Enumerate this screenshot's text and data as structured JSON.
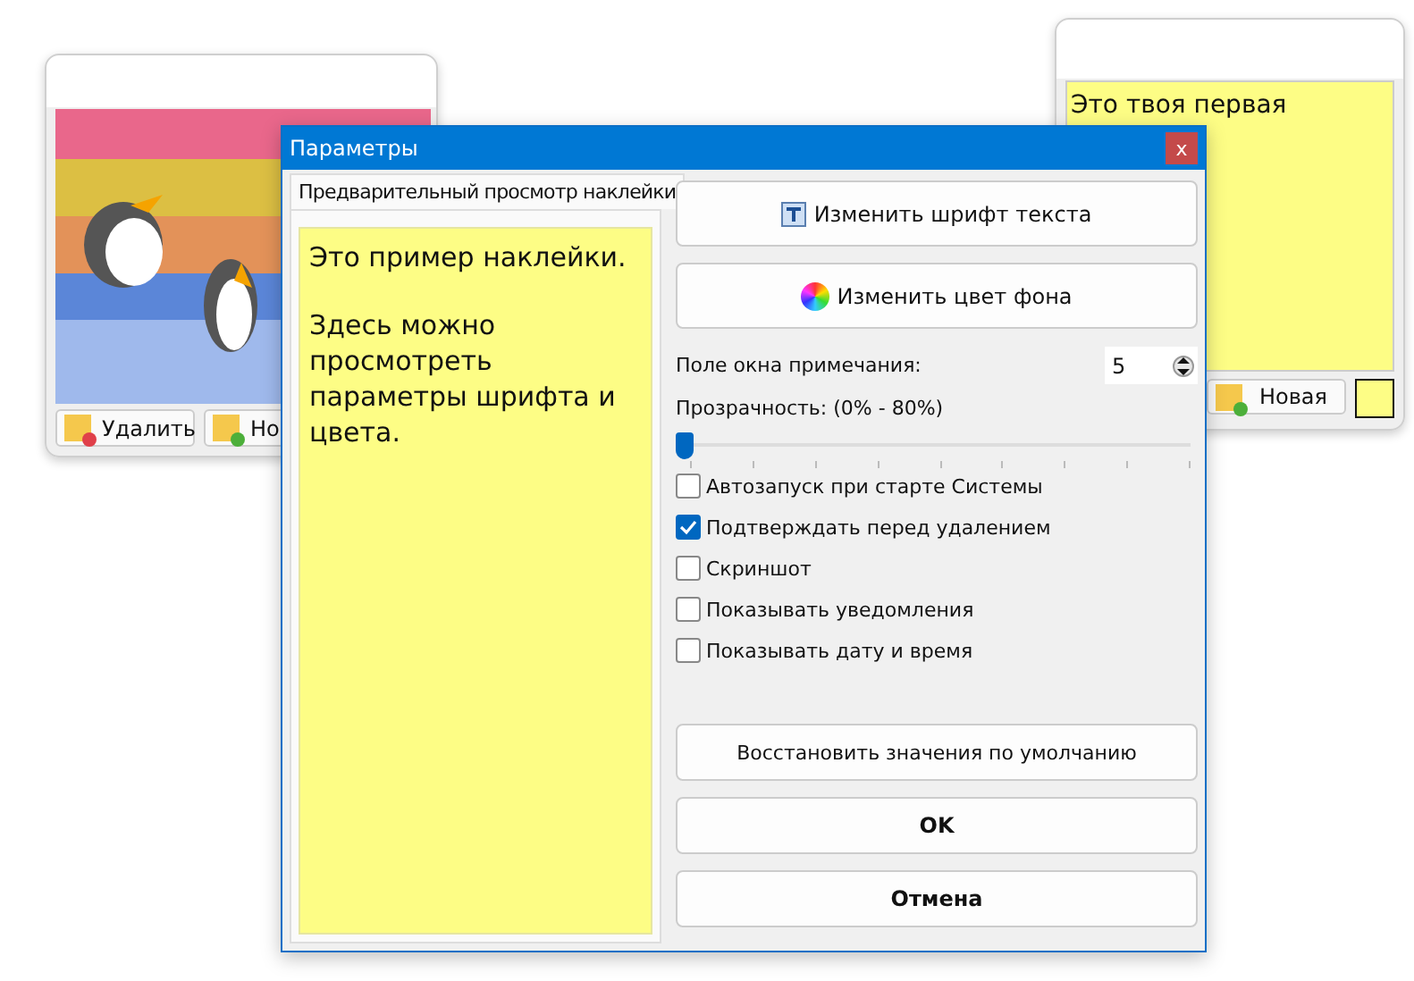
{
  "left_note": {
    "buttons": [
      {
        "label": "Удалить",
        "kind": "delete"
      },
      {
        "label": "Но",
        "kind": "add"
      }
    ]
  },
  "right_note": {
    "text": "Это твоя первая",
    "new_button": "Новая"
  },
  "dialog": {
    "title": "Параметры",
    "close": "x",
    "tab": {
      "label": "Предварительный просмотр наклейки",
      "selected": true
    },
    "preview_text": [
      "Это пример наклейки.",
      "Здесь можно просмотреть параметры шрифта и цвета."
    ],
    "font_button": "Изменить шрифт текста",
    "color_button": "Изменить цвет фона",
    "margin": {
      "label": "Поле окна примечания:",
      "value": "5"
    },
    "transparency": {
      "label": "Прозрачность: (0% - 80%)",
      "level": 0
    },
    "checkboxes": [
      {
        "label": "Автозапуск при старте Системы",
        "checked": false
      },
      {
        "label": "Подтверждать перед удалением",
        "checked": true
      },
      {
        "label": "Скриншот",
        "checked": false
      },
      {
        "label": "Показывать уведомления",
        "checked": false
      },
      {
        "label": "Показывать дату и время",
        "checked": false
      }
    ],
    "restore_button": "Восстановить значения по умолчанию",
    "ok_button": "OK",
    "cancel_button": "Отмена"
  }
}
